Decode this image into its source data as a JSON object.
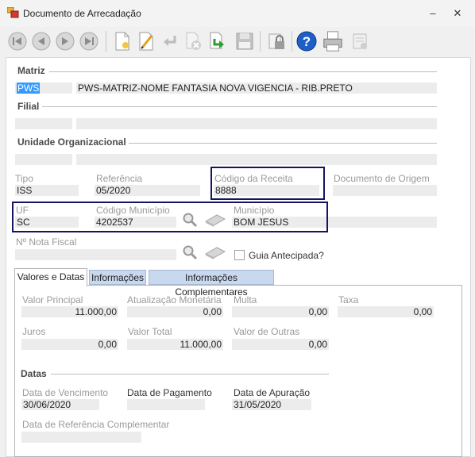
{
  "window": {
    "title": "Documento de Arrecadação",
    "minimize_glyph": "–",
    "close_glyph": "✕"
  },
  "toolbar": {
    "icons": [
      "first-icon",
      "previous-icon",
      "next-icon",
      "last-icon",
      "new-document-icon",
      "edit-icon",
      "undo-icon",
      "delete-icon",
      "redo-icon",
      "save-icon",
      "lock-icon",
      "help-icon",
      "print-icon",
      "report-icon"
    ]
  },
  "matriz": {
    "title": "Matriz",
    "code": "PWS",
    "name": "PWS-MATRIZ-NOME FANTASIA NOVA VIGENCIA  - RIB.PRETO"
  },
  "filial": {
    "title": "Filial",
    "code": "",
    "name": ""
  },
  "unidade": {
    "title": "Unidade Organizacional",
    "code": "",
    "name": ""
  },
  "tipo": {
    "label": "Tipo",
    "value": "ISS"
  },
  "referencia": {
    "label": "Referência",
    "value": "05/2020"
  },
  "codigo_receita": {
    "label": "Código da Receita",
    "value": "8888"
  },
  "documento_origem": {
    "label": "Documento de Origem",
    "value": ""
  },
  "uf": {
    "label": "UF",
    "value": "SC"
  },
  "codigo_municipio": {
    "label": "Código Município",
    "value": "4202537"
  },
  "municipio": {
    "label": "Município",
    "value": "BOM JESUS"
  },
  "nota_fiscal": {
    "label": "Nº Nota Fiscal",
    "value": ""
  },
  "guia_antecipada": {
    "label": "Guia Antecipada?",
    "checked": false
  },
  "tabs": [
    {
      "label": "Valores e Datas",
      "active": true
    },
    {
      "label": "Informações",
      "active": false
    },
    {
      "label": "Informações Complementares",
      "active": false
    }
  ],
  "valores": {
    "valor_principal": {
      "label": "Valor Principal",
      "value": "11.000,00"
    },
    "atualizacao": {
      "label": "Atualização Monetária",
      "value": "0,00"
    },
    "multa": {
      "label": "Multa",
      "value": "0,00"
    },
    "taxa": {
      "label": "Taxa",
      "value": "0,00"
    },
    "juros": {
      "label": "Juros",
      "value": "0,00"
    },
    "valor_total": {
      "label": "Valor Total",
      "value": "11.000,00"
    },
    "valor_outras": {
      "label": "Valor de Outras",
      "value": "0,00"
    }
  },
  "datas": {
    "title": "Datas",
    "vencimento": {
      "label": "Data de Vencimento",
      "value": "30/06/2020"
    },
    "pagamento": {
      "label": "Data de Pagamento",
      "value": ""
    },
    "apuracao": {
      "label": "Data de Apuração",
      "value": "31/05/2020"
    },
    "referencia_complementar": {
      "label": "Data de Referência Complementar",
      "value": ""
    }
  },
  "colors": {
    "highlight_box": "#141462",
    "selection": "#3399ff",
    "inactive_tab": "#c8d8ef",
    "field_bg": "#ececec"
  }
}
